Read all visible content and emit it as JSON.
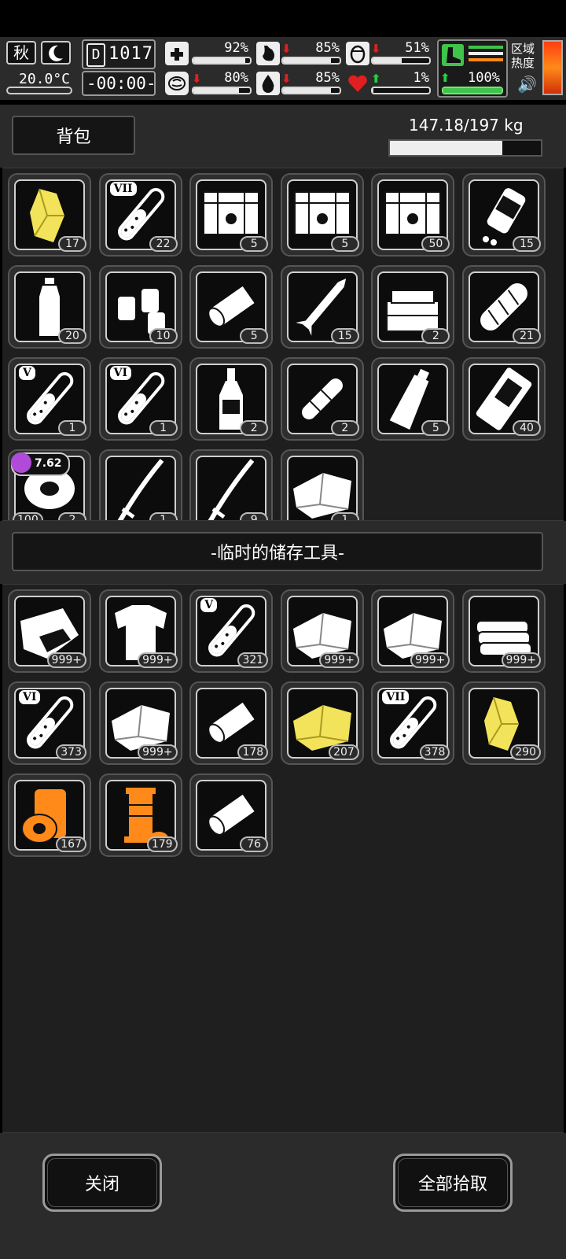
{
  "hud": {
    "season": "秋",
    "temperature": "20.0°C",
    "day": "1017",
    "time": "-00:00-",
    "stats": {
      "health": {
        "value": "92%",
        "level": 0.92
      },
      "stomach": {
        "value": "85%",
        "level": 0.85
      },
      "bladder": {
        "value": "51%",
        "level": 0.51
      },
      "mental": {
        "value": "80%",
        "level": 0.8
      },
      "thirst": {
        "value": "85%",
        "level": 0.85
      },
      "heart": {
        "value": "1%",
        "level": 0.01
      },
      "stamina": {
        "value": "100%",
        "level": 1.0
      }
    },
    "zone_heat_label_1": "区域",
    "zone_heat_label_2": "热度"
  },
  "backpack": {
    "title": "背包",
    "weight": "147.18/197 kg",
    "weight_level": 0.7472,
    "items": [
      {
        "icon": "yellow-crystal-icon",
        "count": "17"
      },
      {
        "icon": "test-tube-vii-icon",
        "tier": "VII",
        "count": "22"
      },
      {
        "icon": "crate-icon",
        "count": "5"
      },
      {
        "icon": "crate-eye-icon",
        "count": "5"
      },
      {
        "icon": "crate-icon",
        "count": "50"
      },
      {
        "icon": "pill-bottle-icon",
        "count": "15"
      },
      {
        "icon": "water-bottle-icon",
        "count": "20"
      },
      {
        "icon": "small-bottles-icon",
        "count": "10"
      },
      {
        "icon": "bandage-roll-icon",
        "count": "5"
      },
      {
        "icon": "rocket-icon",
        "count": "15"
      },
      {
        "icon": "toolbox-icon",
        "count": "2"
      },
      {
        "icon": "bread-icon",
        "count": "21"
      },
      {
        "icon": "test-tube-v-icon",
        "tier": "V",
        "count": "1"
      },
      {
        "icon": "test-tube-vi-icon",
        "tier": "VI",
        "count": "1"
      },
      {
        "icon": "liquor-bottle-icon",
        "count": "2"
      },
      {
        "icon": "rolled-cloth-icon",
        "count": "2"
      },
      {
        "icon": "drink-bottle-icon",
        "count": "5"
      },
      {
        "icon": "food-pack-icon",
        "count": "40"
      },
      {
        "icon": "duct-tape-icon",
        "count": "2",
        "extra": "100",
        "badge": "7.62"
      },
      {
        "icon": "katana-icon",
        "count": "1"
      },
      {
        "icon": "katana-icon",
        "count": "9"
      },
      {
        "icon": "cloth-icon",
        "count": "1"
      }
    ]
  },
  "storage": {
    "title": "-临时的储存工具-",
    "items": [
      {
        "icon": "dirt-bag-icon",
        "count": "999+"
      },
      {
        "icon": "torn-shirt-icon",
        "count": "999+"
      },
      {
        "icon": "test-tube-v-icon",
        "tier": "V",
        "count": "321"
      },
      {
        "icon": "cloth-icon",
        "count": "999+"
      },
      {
        "icon": "cloth-sheet-icon",
        "count": "999+"
      },
      {
        "icon": "folded-towels-icon",
        "count": "999+"
      },
      {
        "icon": "test-tube-vi-icon",
        "tier": "VI",
        "count": "373"
      },
      {
        "icon": "white-sheet-icon",
        "count": "999+"
      },
      {
        "icon": "paper-roll-icon",
        "count": "178"
      },
      {
        "icon": "yellow-cloth-icon",
        "count": "207"
      },
      {
        "icon": "test-tube-vii-icon",
        "tier": "VII",
        "count": "378"
      },
      {
        "icon": "yellow-crystal-icon",
        "count": "290"
      },
      {
        "icon": "orange-tape-icon",
        "count": "167"
      },
      {
        "icon": "orange-spool-icon",
        "count": "179"
      },
      {
        "icon": "bandage-roll-icon",
        "count": "76"
      }
    ]
  },
  "buttons": {
    "close": "关闭",
    "pick_all": "全部拾取"
  },
  "colors": {
    "panel_bg": "#1f1f1f",
    "hud_bg": "#2b2b2b",
    "yellow": "#f2e35a",
    "orange": "#ff8a1a",
    "green": "#3fc34a",
    "red": "#e02020"
  }
}
